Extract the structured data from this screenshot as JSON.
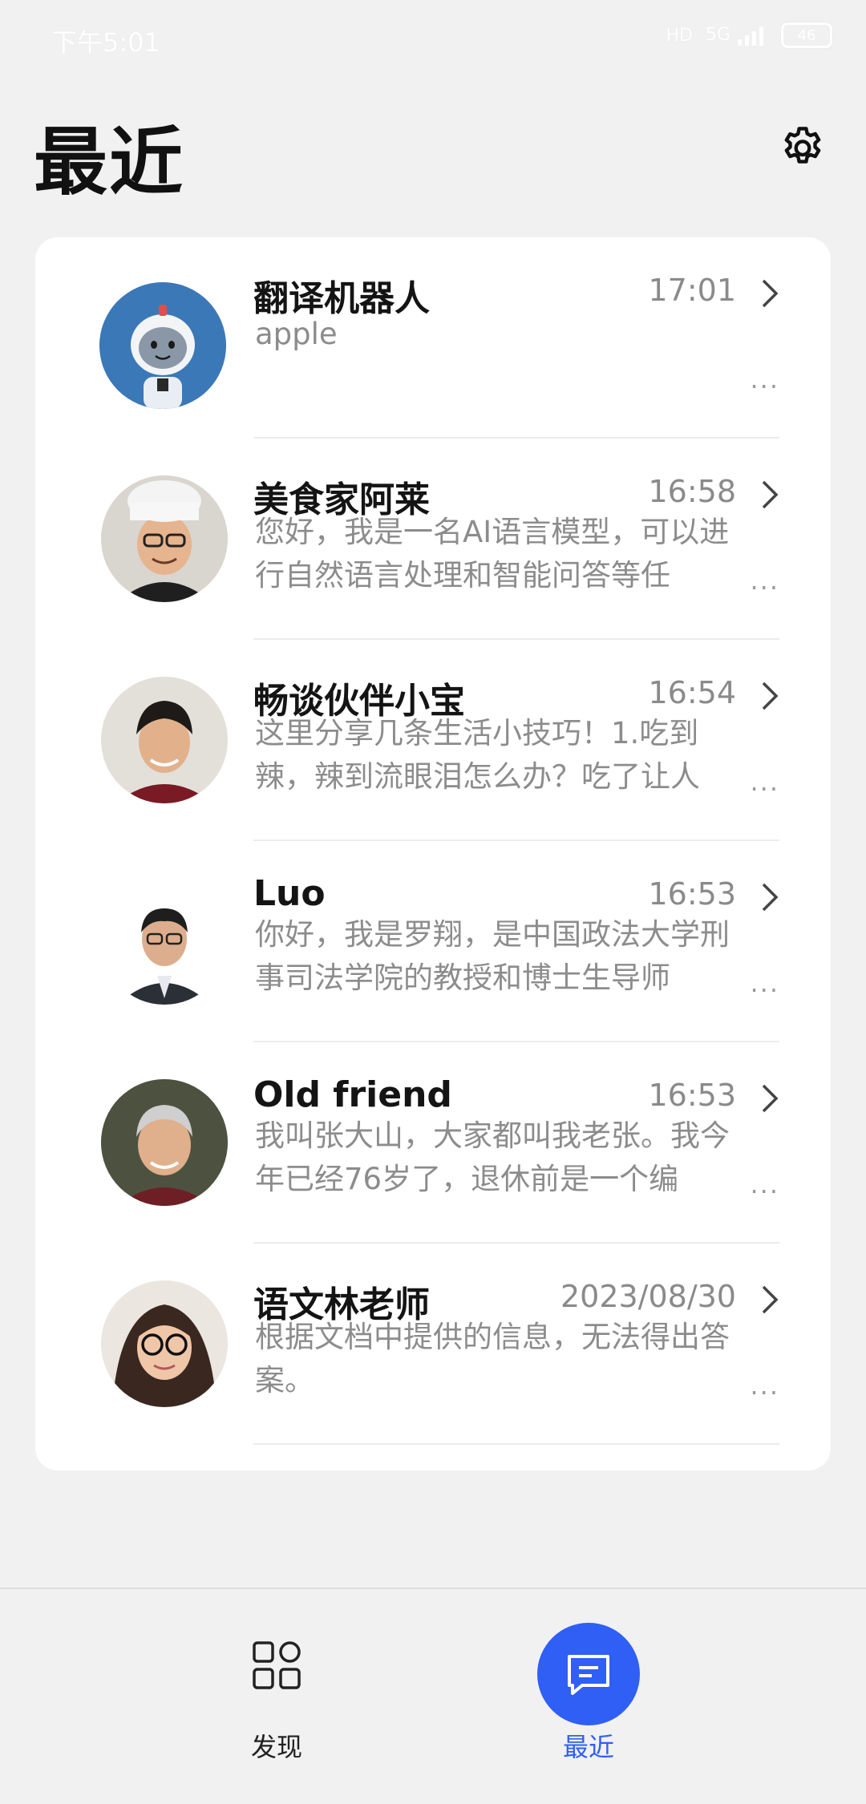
{
  "status_bar": {
    "time": "下午5:01",
    "hd": "HD",
    "network": "5G",
    "battery": "46"
  },
  "header": {
    "title": "最近",
    "settings_icon": "gear-icon"
  },
  "conversations": [
    {
      "name": "翻译机器人",
      "time": "17:01",
      "preview": "apple",
      "avatar": "robot-avatar"
    },
    {
      "name": "美食家阿莱",
      "time": "16:58",
      "preview": "您好，我是一名AI语言模型，可以进行自然语言处理和智能问答等任",
      "avatar": "chef-avatar"
    },
    {
      "name": "畅谈伙伴小宝",
      "time": "16:54",
      "preview": "这里分享几条生活小技巧！1.吃到辣，辣到流眼泪怎么办？吃了让人",
      "avatar": "young-man-avatar"
    },
    {
      "name": "Luo",
      "time": "16:53",
      "preview": "你好，我是罗翔，是中国政法大学刑事司法学院的教授和博士生导师",
      "avatar": "professor-avatar"
    },
    {
      "name": "Old friend",
      "time": "16:53",
      "preview": "我叫张大山，大家都叫我老张。我今年已经76岁了，退休前是一个编",
      "avatar": "old-man-avatar"
    },
    {
      "name": "语文林老师",
      "time": "2023/08/30",
      "preview": "根据文档中提供的信息，无法得出答案。",
      "avatar": "teacher-avatar"
    }
  ],
  "more_glyph": "...",
  "bottom_nav": {
    "discover": {
      "label": "发现",
      "icon": "grid-icon",
      "active": false
    },
    "recent": {
      "label": "最近",
      "icon": "chat-icon",
      "active": true
    }
  },
  "colors": {
    "accent": "#2f5ff5",
    "background": "#f1f1f1",
    "card": "#ffffff",
    "muted": "#8c8c8c"
  }
}
